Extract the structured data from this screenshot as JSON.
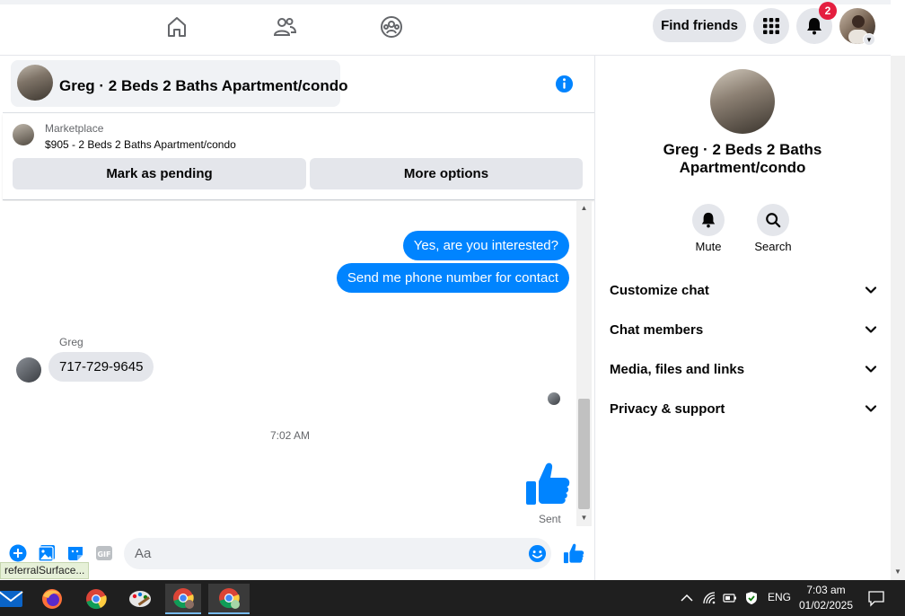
{
  "topbar": {
    "find_friends_label": "Find friends",
    "notification_count": "2"
  },
  "chat": {
    "header_title": "Greg · 2 Beds 2 Baths Apartment/condo",
    "marketplace_label": "Marketplace",
    "listing_text": "$905 - 2 Beds 2 Baths Apartment/condo",
    "mark_pending_label": "Mark as pending",
    "more_options_label": "More options",
    "messages": [
      {
        "direction": "out",
        "text": "Yes, are you interested?"
      },
      {
        "direction": "out",
        "text": "Send me phone number for contact"
      },
      {
        "direction": "in",
        "sender": "Greg",
        "text": "717-729-9645"
      }
    ],
    "timestamp": "7:02 AM",
    "sent_label": "Sent",
    "composer_placeholder": "Aa"
  },
  "status_url": "referralSurface...",
  "right_panel": {
    "title": "Greg · 2 Beds 2 Baths Apartment/condo",
    "mute_label": "Mute",
    "search_label": "Search",
    "sections": [
      "Customize chat",
      "Chat members",
      "Media, files and links",
      "Privacy & support"
    ]
  },
  "taskbar": {
    "language": "ENG",
    "time": "7:03 am",
    "date": "01/02/2025"
  },
  "colors": {
    "messenger_blue": "#0084ff",
    "badge_red": "#e41e3f",
    "button_gray": "#e4e6eb"
  }
}
